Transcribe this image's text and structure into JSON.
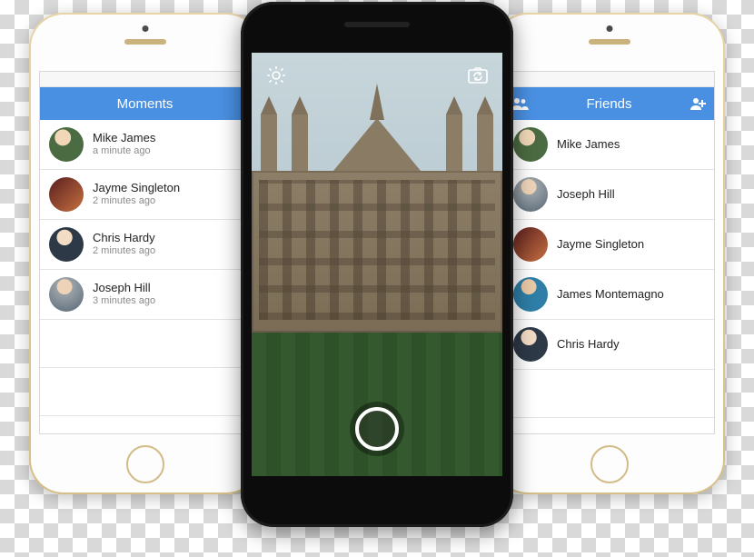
{
  "moments": {
    "title": "Moments",
    "items": [
      {
        "name": "Mike James",
        "sub": "a minute ago"
      },
      {
        "name": "Jayme Singleton",
        "sub": "2 minutes ago"
      },
      {
        "name": "Chris Hardy",
        "sub": "2 minutes ago"
      },
      {
        "name": "Joseph Hill",
        "sub": "3 minutes ago"
      }
    ]
  },
  "friends": {
    "title": "Friends",
    "items": [
      {
        "name": "Mike James"
      },
      {
        "name": "Joseph Hill"
      },
      {
        "name": "Jayme Singleton"
      },
      {
        "name": "James Montemagno"
      },
      {
        "name": "Chris Hardy"
      }
    ]
  },
  "icons": {
    "brightness": "brightness-icon",
    "switch_camera": "switch-camera-icon",
    "friends_group": "friends-group-icon",
    "add_friend": "add-friend-icon"
  }
}
